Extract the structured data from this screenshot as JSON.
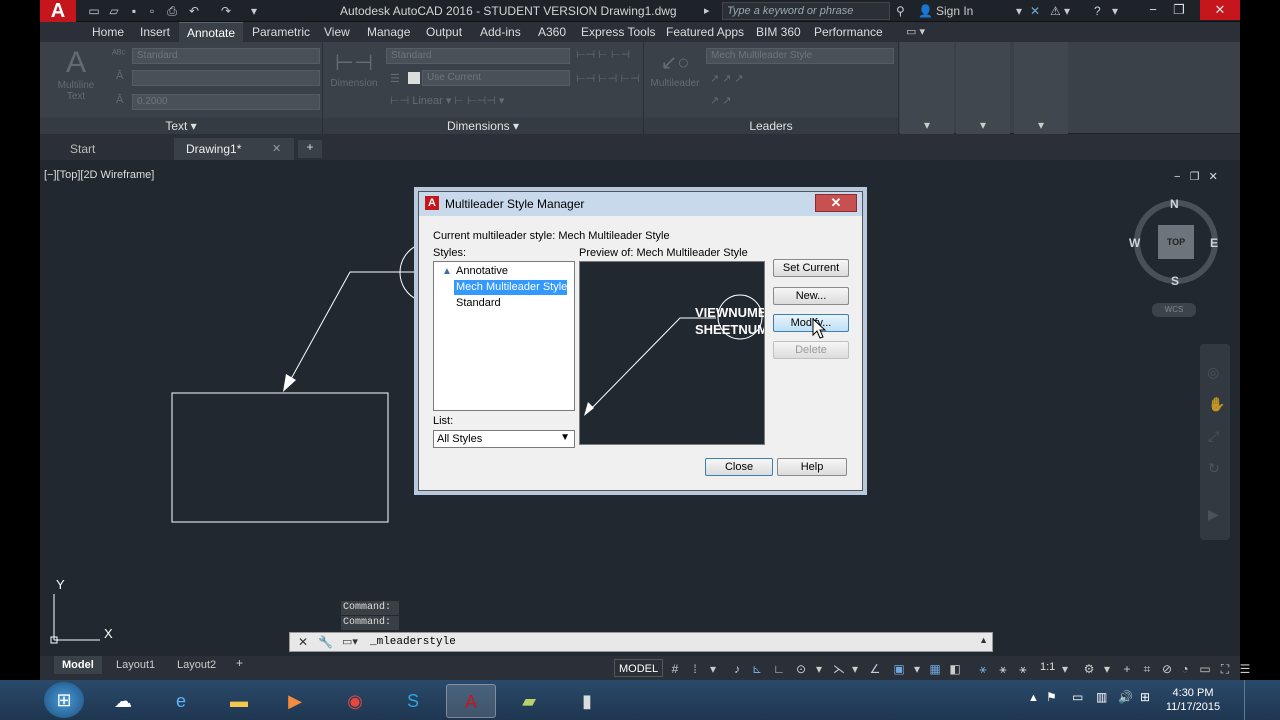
{
  "title_bar": {
    "app_title": "Autodesk AutoCAD 2016 - STUDENT VERSION   Drawing1.dwg",
    "search_placeholder": "Type a keyword or phrase",
    "sign_in": "Sign In",
    "app_logo_letter": "A"
  },
  "ribbon_tabs": [
    "Home",
    "Insert",
    "Annotate",
    "Parametric",
    "View",
    "Manage",
    "Output",
    "Add-ins",
    "A360",
    "Express Tools",
    "Featured Apps",
    "BIM 360",
    "Performance"
  ],
  "active_ribbon_tab": "Annotate",
  "ribbon": {
    "text_panel": {
      "label": "Text",
      "big_button_line1": "Multiline",
      "big_button_line2": "Text",
      "style_value": "Standard",
      "height_value": "0.2000"
    },
    "dimensions_panel": {
      "label": "Dimensions",
      "big_button": "Dimension",
      "style_value": "Standard",
      "layer_value": "Use Current"
    },
    "leaders_panel": {
      "label": "Leaders",
      "big_button": "Multileader",
      "style_value": "Mech Multileader Style"
    }
  },
  "file_tabs": [
    {
      "label": "Start",
      "active": false
    },
    {
      "label": "Drawing1*",
      "active": true
    }
  ],
  "viewport_label": "[−][Top][2D Wireframe]",
  "viewcube": {
    "n": "N",
    "s": "S",
    "e": "E",
    "w": "W",
    "top": "TOP",
    "ucs": "WCS"
  },
  "dialog": {
    "title": "Multileader Style Manager",
    "current_style_text": "Current multileader style: Mech Multileader Style",
    "styles_label": "Styles:",
    "styles": [
      "Annotative",
      "Mech Multileader Style",
      "Standard"
    ],
    "selected_style": "Mech Multileader Style",
    "preview_label": "Preview of: Mech Multileader Style",
    "preview_text_line1": "VIEWNUMB",
    "preview_text_line2": "SHEETNUM",
    "list_label": "List:",
    "list_value": "All Styles",
    "buttons": {
      "set_current": "Set Current",
      "new": "New...",
      "modify": "Modify...",
      "delete": "Delete",
      "close": "Close",
      "help": "Help"
    }
  },
  "ucs_axis": {
    "y": "Y",
    "x": "X"
  },
  "command": {
    "history": [
      "Command:",
      "Command:"
    ],
    "current": "_mleaderstyle"
  },
  "layout_tabs": [
    {
      "label": "Model",
      "active": true
    },
    {
      "label": "Layout1",
      "active": false
    },
    {
      "label": "Layout2",
      "active": false
    }
  ],
  "status": {
    "model_label": "MODEL",
    "scale": "1:1"
  },
  "taskbar": {
    "time": "4:30 PM",
    "date": "11/17/2015"
  }
}
